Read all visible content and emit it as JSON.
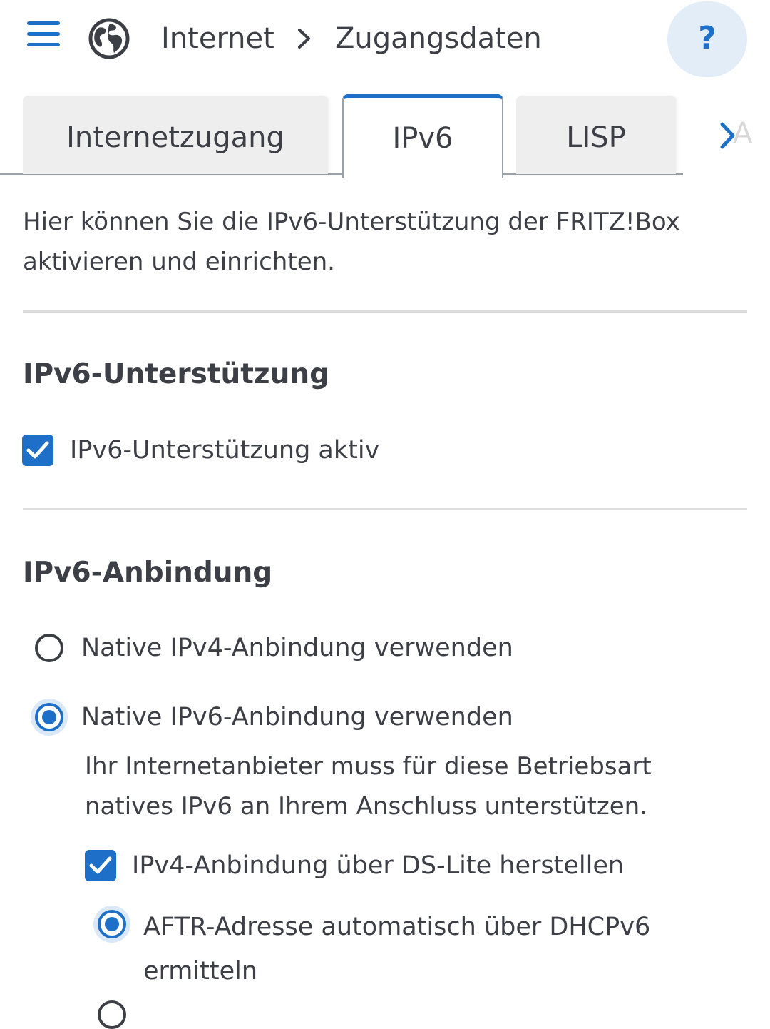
{
  "header": {
    "breadcrumb": [
      "Internet",
      "Zugangsdaten"
    ],
    "help_label": "?",
    "menu_icon": "hamburger-menu-icon",
    "globe_icon": "globe-icon"
  },
  "tabs": {
    "items": [
      {
        "label": "Internetzugang",
        "active": false
      },
      {
        "label": "IPv6",
        "active": true
      },
      {
        "label": "LISP",
        "active": false
      }
    ],
    "more_peek": "A",
    "accent_color": "#1d6fc7"
  },
  "intro_text": "Hier können Sie die IPv6-Unterstützung der FRITZ!Box aktivieren und einrichten.",
  "support_section": {
    "title": "IPv6-Unterstützung",
    "checkbox_label": "IPv6-Unterstützung aktiv",
    "checked": true
  },
  "binding_section": {
    "title": "IPv6-Anbindung",
    "options": [
      {
        "label": "Native IPv4-Anbindung verwenden",
        "selected": false
      },
      {
        "label": "Native IPv6-Anbindung verwenden",
        "selected": true
      }
    ],
    "ipv6_hint": "Ihr Internetanbieter muss für diese Betriebsart natives IPv6 an Ihrem Anschluss unterstützen.",
    "dslite_label": "IPv4-Anbindung über DS-Lite herstellen",
    "dslite_checked": true,
    "aftr_auto_label": "AFTR-Adresse automatisch über DHCPv6 ermitteln",
    "aftr_auto_selected": true
  }
}
